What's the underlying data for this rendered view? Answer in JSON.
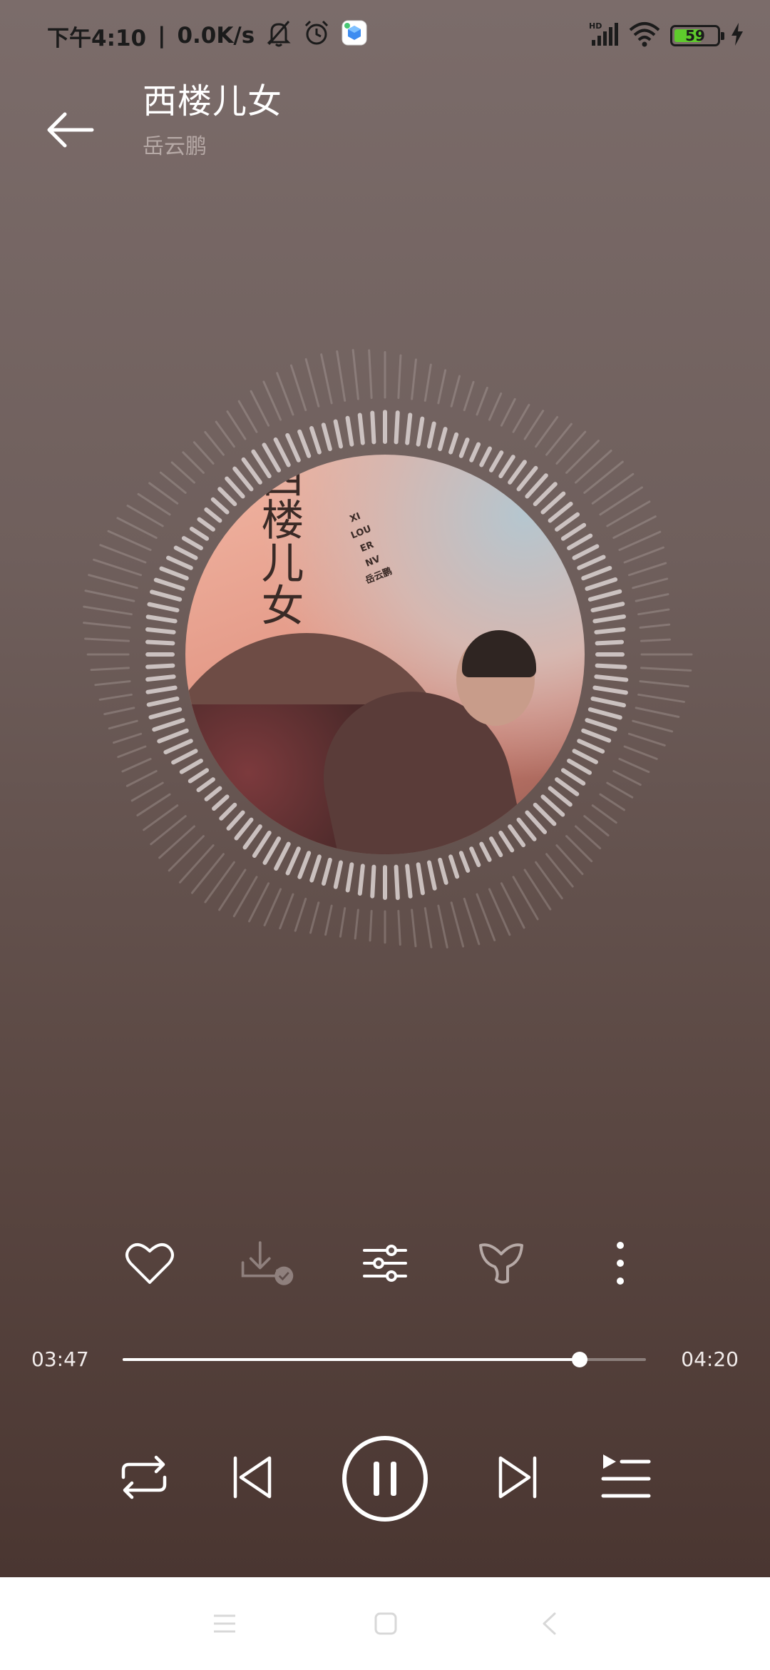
{
  "status_bar": {
    "time": "下午4:10",
    "separator": "|",
    "network_speed": "0.0K/s",
    "hd_label": "HD",
    "battery_level": "59"
  },
  "header": {
    "title": "西楼儿女",
    "artist": "岳云鹏"
  },
  "album": {
    "cover_title": "西楼儿女",
    "cover_pinyin": [
      "XI",
      "LOU",
      "ER",
      "NV"
    ],
    "cover_artist": "岳云鹏"
  },
  "actions": {
    "icons": [
      "heart-icon",
      "download-icon",
      "equalizer-icon",
      "ringtone-icon",
      "more-icon"
    ]
  },
  "progress": {
    "current_time": "03:47",
    "total_time": "04:20",
    "fraction": 0.873
  },
  "controls": {
    "icons": [
      "repeat-icon",
      "previous-icon",
      "pause-icon",
      "next-icon",
      "playlist-icon"
    ]
  },
  "colors": {
    "background_top": "#7b6c6a",
    "background_bottom": "#4a3631",
    "accent": "#ffffff",
    "battery_fill": "#5ecb2c"
  }
}
